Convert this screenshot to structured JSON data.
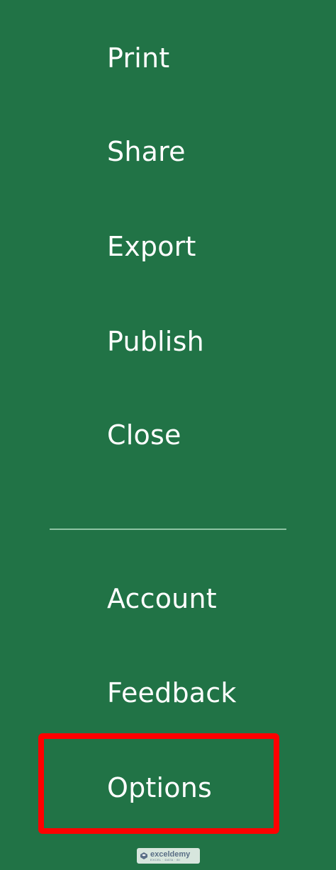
{
  "backstage": {
    "items_top": [
      {
        "id": "print",
        "label": "Print"
      },
      {
        "id": "share",
        "label": "Share"
      },
      {
        "id": "export",
        "label": "Export"
      },
      {
        "id": "publish",
        "label": "Publish"
      },
      {
        "id": "close",
        "label": "Close"
      }
    ],
    "items_bottom": [
      {
        "id": "account",
        "label": "Account"
      },
      {
        "id": "feedback",
        "label": "Feedback"
      },
      {
        "id": "options",
        "label": "Options"
      }
    ],
    "highlighted_item": "options"
  },
  "watermark": {
    "name": "exceldemy",
    "tagline": "EXCEL · DATA · BI"
  },
  "colors": {
    "background": "#217346",
    "text": "#ffffff",
    "separator": "#8fc3a4",
    "highlight": "#ff0000"
  },
  "icons": {
    "watermark": "exceldemy-logo-icon"
  }
}
